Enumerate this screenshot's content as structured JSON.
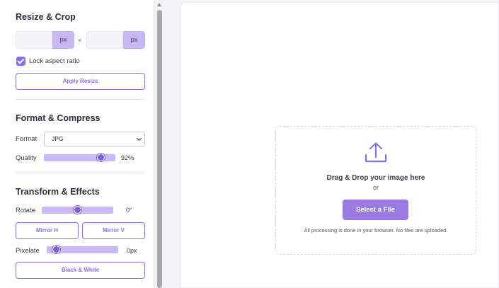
{
  "resize": {
    "title": "Resize & Crop",
    "width_value": "",
    "height_value": "",
    "unit": "px",
    "separator": "×",
    "lock_label": "Lock aspect ratio",
    "lock_checked": true,
    "apply_label": "Apply Resize"
  },
  "format": {
    "title": "Format & Compress",
    "format_label": "Format",
    "format_value": "JPG",
    "quality_label": "Quality",
    "quality_value": "92%",
    "quality_level": 0.92
  },
  "transform": {
    "title": "Transform & Effects",
    "rotate_label": "Rotate",
    "rotate_value": "0°",
    "rotate_level": 0.5,
    "mirror_h_label": "Mirror H",
    "mirror_v_label": "Mirror V",
    "pixelate_label": "Pixelate",
    "pixelate_value": "0px",
    "pixelate_level": 0.0,
    "bw_label": "Black & White"
  },
  "dropzone": {
    "icon": "upload-icon",
    "title": "Drag & Drop your image here",
    "or": "or",
    "button_label": "Select a File",
    "note": "All processing is done in your browser. No files are uploaded."
  },
  "colors": {
    "accent": "#8b6fe0",
    "accent_light": "#c9b8f4",
    "button_fill": "#9a7be4"
  }
}
